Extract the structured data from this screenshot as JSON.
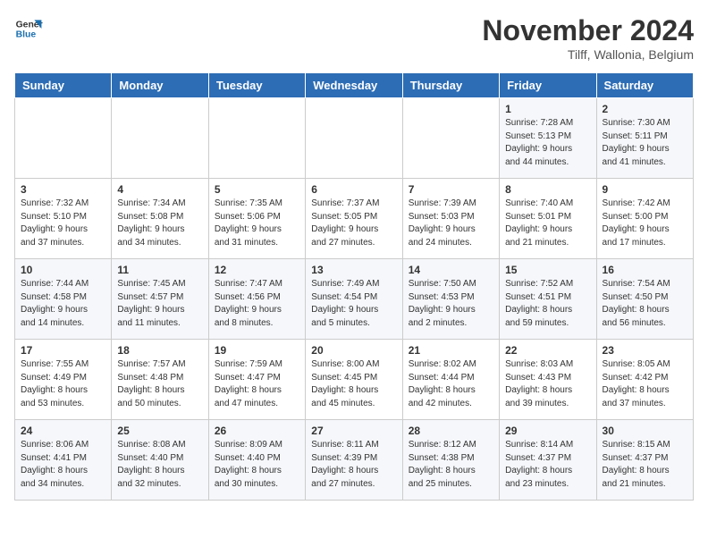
{
  "logo": {
    "line1": "General",
    "line2": "Blue"
  },
  "title": "November 2024",
  "subtitle": "Tilff, Wallonia, Belgium",
  "days_of_week": [
    "Sunday",
    "Monday",
    "Tuesday",
    "Wednesday",
    "Thursday",
    "Friday",
    "Saturday"
  ],
  "weeks": [
    [
      {
        "day": "",
        "info": ""
      },
      {
        "day": "",
        "info": ""
      },
      {
        "day": "",
        "info": ""
      },
      {
        "day": "",
        "info": ""
      },
      {
        "day": "",
        "info": ""
      },
      {
        "day": "1",
        "info": "Sunrise: 7:28 AM\nSunset: 5:13 PM\nDaylight: 9 hours\nand 44 minutes."
      },
      {
        "day": "2",
        "info": "Sunrise: 7:30 AM\nSunset: 5:11 PM\nDaylight: 9 hours\nand 41 minutes."
      }
    ],
    [
      {
        "day": "3",
        "info": "Sunrise: 7:32 AM\nSunset: 5:10 PM\nDaylight: 9 hours\nand 37 minutes."
      },
      {
        "day": "4",
        "info": "Sunrise: 7:34 AM\nSunset: 5:08 PM\nDaylight: 9 hours\nand 34 minutes."
      },
      {
        "day": "5",
        "info": "Sunrise: 7:35 AM\nSunset: 5:06 PM\nDaylight: 9 hours\nand 31 minutes."
      },
      {
        "day": "6",
        "info": "Sunrise: 7:37 AM\nSunset: 5:05 PM\nDaylight: 9 hours\nand 27 minutes."
      },
      {
        "day": "7",
        "info": "Sunrise: 7:39 AM\nSunset: 5:03 PM\nDaylight: 9 hours\nand 24 minutes."
      },
      {
        "day": "8",
        "info": "Sunrise: 7:40 AM\nSunset: 5:01 PM\nDaylight: 9 hours\nand 21 minutes."
      },
      {
        "day": "9",
        "info": "Sunrise: 7:42 AM\nSunset: 5:00 PM\nDaylight: 9 hours\nand 17 minutes."
      }
    ],
    [
      {
        "day": "10",
        "info": "Sunrise: 7:44 AM\nSunset: 4:58 PM\nDaylight: 9 hours\nand 14 minutes."
      },
      {
        "day": "11",
        "info": "Sunrise: 7:45 AM\nSunset: 4:57 PM\nDaylight: 9 hours\nand 11 minutes."
      },
      {
        "day": "12",
        "info": "Sunrise: 7:47 AM\nSunset: 4:56 PM\nDaylight: 9 hours\nand 8 minutes."
      },
      {
        "day": "13",
        "info": "Sunrise: 7:49 AM\nSunset: 4:54 PM\nDaylight: 9 hours\nand 5 minutes."
      },
      {
        "day": "14",
        "info": "Sunrise: 7:50 AM\nSunset: 4:53 PM\nDaylight: 9 hours\nand 2 minutes."
      },
      {
        "day": "15",
        "info": "Sunrise: 7:52 AM\nSunset: 4:51 PM\nDaylight: 8 hours\nand 59 minutes."
      },
      {
        "day": "16",
        "info": "Sunrise: 7:54 AM\nSunset: 4:50 PM\nDaylight: 8 hours\nand 56 minutes."
      }
    ],
    [
      {
        "day": "17",
        "info": "Sunrise: 7:55 AM\nSunset: 4:49 PM\nDaylight: 8 hours\nand 53 minutes."
      },
      {
        "day": "18",
        "info": "Sunrise: 7:57 AM\nSunset: 4:48 PM\nDaylight: 8 hours\nand 50 minutes."
      },
      {
        "day": "19",
        "info": "Sunrise: 7:59 AM\nSunset: 4:47 PM\nDaylight: 8 hours\nand 47 minutes."
      },
      {
        "day": "20",
        "info": "Sunrise: 8:00 AM\nSunset: 4:45 PM\nDaylight: 8 hours\nand 45 minutes."
      },
      {
        "day": "21",
        "info": "Sunrise: 8:02 AM\nSunset: 4:44 PM\nDaylight: 8 hours\nand 42 minutes."
      },
      {
        "day": "22",
        "info": "Sunrise: 8:03 AM\nSunset: 4:43 PM\nDaylight: 8 hours\nand 39 minutes."
      },
      {
        "day": "23",
        "info": "Sunrise: 8:05 AM\nSunset: 4:42 PM\nDaylight: 8 hours\nand 37 minutes."
      }
    ],
    [
      {
        "day": "24",
        "info": "Sunrise: 8:06 AM\nSunset: 4:41 PM\nDaylight: 8 hours\nand 34 minutes."
      },
      {
        "day": "25",
        "info": "Sunrise: 8:08 AM\nSunset: 4:40 PM\nDaylight: 8 hours\nand 32 minutes."
      },
      {
        "day": "26",
        "info": "Sunrise: 8:09 AM\nSunset: 4:40 PM\nDaylight: 8 hours\nand 30 minutes."
      },
      {
        "day": "27",
        "info": "Sunrise: 8:11 AM\nSunset: 4:39 PM\nDaylight: 8 hours\nand 27 minutes."
      },
      {
        "day": "28",
        "info": "Sunrise: 8:12 AM\nSunset: 4:38 PM\nDaylight: 8 hours\nand 25 minutes."
      },
      {
        "day": "29",
        "info": "Sunrise: 8:14 AM\nSunset: 4:37 PM\nDaylight: 8 hours\nand 23 minutes."
      },
      {
        "day": "30",
        "info": "Sunrise: 8:15 AM\nSunset: 4:37 PM\nDaylight: 8 hours\nand 21 minutes."
      }
    ]
  ]
}
